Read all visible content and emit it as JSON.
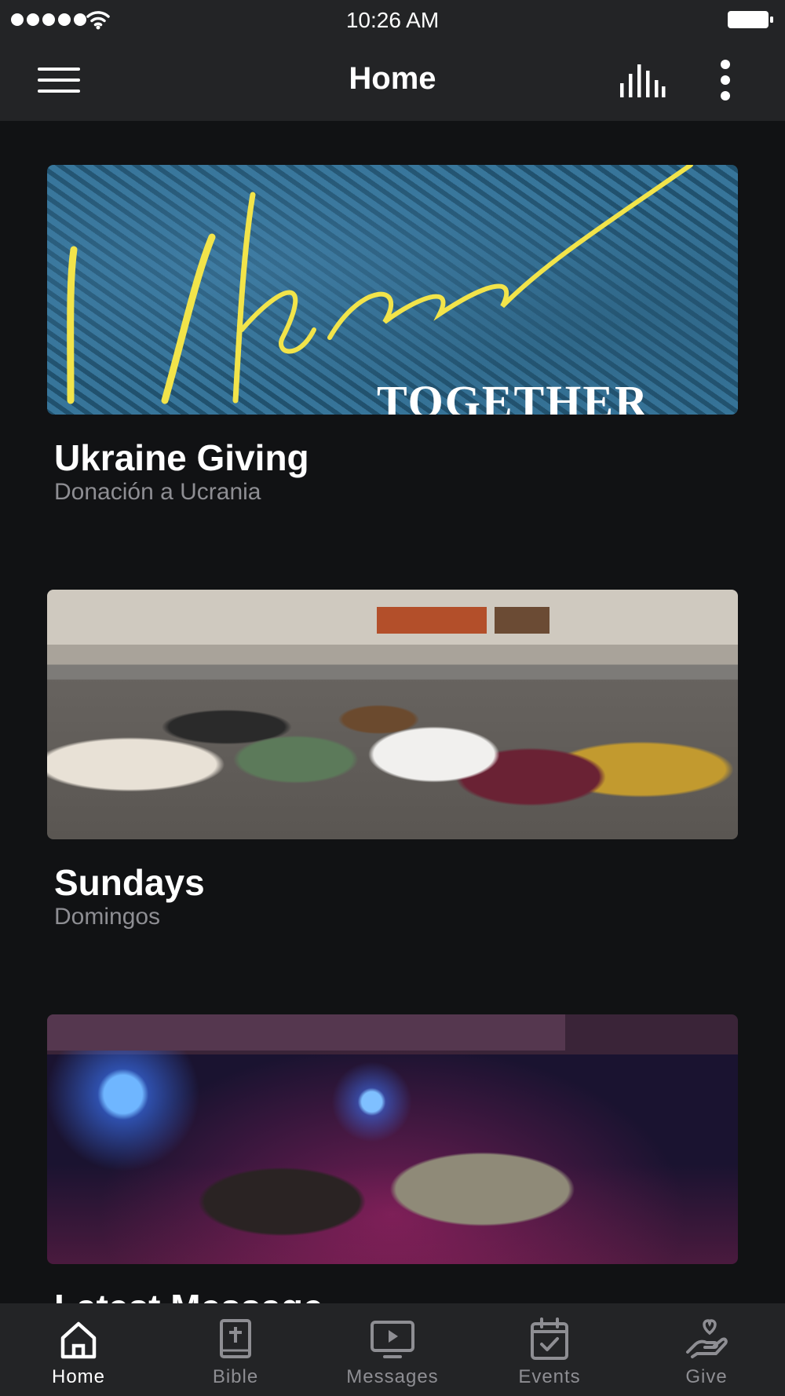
{
  "status_bar": {
    "time": "10:26 AM"
  },
  "header": {
    "title": "Home"
  },
  "feed": {
    "cards": [
      {
        "title": "Ukraine Giving",
        "subtitle": "Donación a Ucrania",
        "image_script_text": "Ukraine",
        "image_banner_text": "TOGETHER"
      },
      {
        "title": "Sundays",
        "subtitle": "Domingos"
      },
      {
        "title": "Latest Message",
        "subtitle": ""
      }
    ]
  },
  "tabs": [
    {
      "label": "Home",
      "icon": "home-icon",
      "active": true
    },
    {
      "label": "Bible",
      "icon": "bible-icon",
      "active": false
    },
    {
      "label": "Messages",
      "icon": "messages-icon",
      "active": false
    },
    {
      "label": "Events",
      "icon": "events-icon",
      "active": false
    },
    {
      "label": "Give",
      "icon": "give-icon",
      "active": false
    }
  ],
  "colors": {
    "background": "#111214",
    "bar": "#232426",
    "subtitle": "#8e8e93",
    "accent_yellow": "#f2e44a"
  }
}
